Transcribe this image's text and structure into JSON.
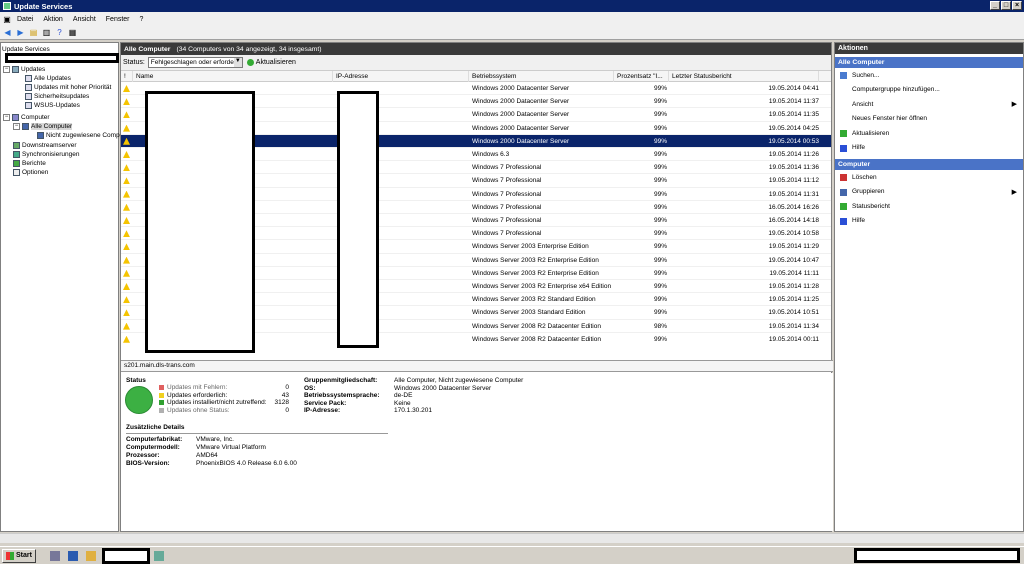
{
  "window": {
    "title": "Update Services"
  },
  "menu": [
    "Datei",
    "Aktion",
    "Ansicht",
    "Fenster",
    "?"
  ],
  "tree": {
    "root": "Update Services",
    "items": [
      {
        "label": "Updates",
        "level": 0
      },
      {
        "label": "Alle Updates",
        "level": 1
      },
      {
        "label": "Updates mit hoher Priorität",
        "level": 1
      },
      {
        "label": "Sicherheitsupdates",
        "level": 1
      },
      {
        "label": "WSUS-Updates",
        "level": 1
      },
      {
        "label": "Computer",
        "level": 0
      },
      {
        "label": "Alle Computer",
        "level": 1
      },
      {
        "label": "Nicht zugewiesene Comp",
        "level": 2
      },
      {
        "label": "Downstreamserver",
        "level": 0
      },
      {
        "label": "Synchronisierungen",
        "level": 0
      },
      {
        "label": "Berichte",
        "level": 0
      },
      {
        "label": "Optionen",
        "level": 0
      }
    ]
  },
  "center": {
    "title": "Alle Computer",
    "subtitle": "(34 Computers von 34 angezeigt, 34 insgesamt)",
    "status_label": "Status:",
    "status_value": "Fehlgeschlagen oder erforderlic",
    "refresh_label": "Aktualisieren",
    "columns": [
      "!",
      "Name",
      "IP-Adresse",
      "Betriebssystem",
      "Prozentsatz \"I...",
      "Letzter Statusbericht"
    ],
    "rows": [
      {
        "os": "Windows 2000 Datacenter Server",
        "pct": "99%",
        "report": "19.05.2014 04:41",
        "selected": false
      },
      {
        "os": "Windows 2000 Datacenter Server",
        "pct": "99%",
        "report": "19.05.2014 11:37",
        "selected": false
      },
      {
        "os": "Windows 2000 Datacenter Server",
        "pct": "99%",
        "report": "19.05.2014 11:35",
        "selected": false
      },
      {
        "os": "Windows 2000 Datacenter Server",
        "pct": "99%",
        "report": "19.05.2014 04:25",
        "selected": false
      },
      {
        "os": "Windows 2000 Datacenter Server",
        "pct": "99%",
        "report": "19.05.2014 00:53",
        "selected": true
      },
      {
        "os": "Windows 6.3",
        "pct": "99%",
        "report": "19.05.2014 11:26",
        "selected": false
      },
      {
        "os": "Windows 7 Professional",
        "pct": "99%",
        "report": "19.05.2014 11:36",
        "selected": false
      },
      {
        "os": "Windows 7 Professional",
        "pct": "99%",
        "report": "19.05.2014 11:12",
        "selected": false
      },
      {
        "os": "Windows 7 Professional",
        "pct": "99%",
        "report": "19.05.2014 11:31",
        "selected": false
      },
      {
        "os": "Windows 7 Professional",
        "pct": "99%",
        "report": "16.05.2014 16:26",
        "selected": false
      },
      {
        "os": "Windows 7 Professional",
        "pct": "99%",
        "report": "16.05.2014 14:18",
        "selected": false
      },
      {
        "os": "Windows 7 Professional",
        "pct": "99%",
        "report": "19.05.2014 10:58",
        "selected": false
      },
      {
        "os": "Windows Server 2003 Enterprise Edition",
        "pct": "99%",
        "report": "19.05.2014 11:29",
        "selected": false
      },
      {
        "os": "Windows Server 2003 R2 Enterprise Edition",
        "pct": "99%",
        "report": "19.05.2014 10:47",
        "selected": false
      },
      {
        "os": "Windows Server 2003 R2 Enterprise Edition",
        "pct": "99%",
        "report": "19.05.2014 11:11",
        "selected": false
      },
      {
        "os": "Windows Server 2003 R2 Enterprise x64 Edition",
        "pct": "99%",
        "report": "19.05.2014 11:28",
        "selected": false
      },
      {
        "os": "Windows Server 2003 R2 Standard Edition",
        "pct": "99%",
        "report": "19.05.2014 11:25",
        "selected": false
      },
      {
        "os": "Windows Server 2003 Standard Edition",
        "pct": "99%",
        "report": "19.05.2014 10:51",
        "selected": false
      },
      {
        "os": "Windows Server 2008 R2 Datacenter Edition",
        "pct": "98%",
        "report": "19.05.2014 11:34",
        "selected": false
      },
      {
        "os": "Windows Server 2008 R2 Datacenter Edition",
        "pct": "99%",
        "report": "19.05.2014 00:11",
        "selected": false
      }
    ],
    "selected_name": "s201.main.dls-trans.com"
  },
  "details": {
    "status_title": "Status",
    "legend": [
      {
        "label": "Updates mit Fehlern:",
        "value": "0",
        "color": "#e06060"
      },
      {
        "label": "Updates erforderlich:",
        "value": "43",
        "color": "#f0d020"
      },
      {
        "label": "Updates installiert/nicht zutreffend:",
        "value": "3128",
        "color": "#30a030"
      },
      {
        "label": "Updates ohne Status:",
        "value": "0",
        "color": "#b0b0b0"
      }
    ],
    "info": [
      {
        "key": "Gruppenmitgliedschaft:",
        "value": "Alle Computer, Nicht zugewiesene Computer"
      },
      {
        "key": "OS:",
        "value": "Windows 2000 Datacenter Server"
      },
      {
        "key": "Betriebssystemsprache:",
        "value": "de-DE"
      },
      {
        "key": "Service Pack:",
        "value": "Keine"
      },
      {
        "key": "IP-Adresse:",
        "value": "170.1.30.201"
      }
    ],
    "extra_title": "Zusätzliche Details",
    "extra": [
      {
        "key": "Computerfabrikat:",
        "value": "VMware, Inc."
      },
      {
        "key": "Computermodell:",
        "value": "VMware Virtual Platform"
      },
      {
        "key": "Prozessor:",
        "value": "AMD64"
      },
      {
        "key": "BIOS-Version:",
        "value": "PhoenixBIOS 4.0 Release 6.0     6.00"
      }
    ]
  },
  "actions": {
    "title": "Aktionen",
    "group1": "Alle Computer",
    "items1": [
      {
        "label": "Suchen...",
        "icon": "search-icon",
        "arrow": false
      },
      {
        "label": "Computergruppe hinzufügen...",
        "icon": "",
        "arrow": false
      },
      {
        "label": "Ansicht",
        "icon": "",
        "arrow": true
      },
      {
        "label": "Neues Fenster hier öffnen",
        "icon": "",
        "arrow": false
      },
      {
        "label": "Aktualisieren",
        "icon": "refresh-icon",
        "arrow": false
      },
      {
        "label": "Hilfe",
        "icon": "help-icon",
        "arrow": false
      }
    ],
    "group2": "Computer",
    "items2": [
      {
        "label": "Löschen",
        "icon": "delete-icon",
        "arrow": false
      },
      {
        "label": "Gruppieren",
        "icon": "group-icon",
        "arrow": true
      },
      {
        "label": "Statusbericht",
        "icon": "report-icon",
        "arrow": false
      },
      {
        "label": "Hilfe",
        "icon": "help-icon",
        "arrow": false
      }
    ]
  },
  "taskbar": {
    "start_label": "Start"
  }
}
